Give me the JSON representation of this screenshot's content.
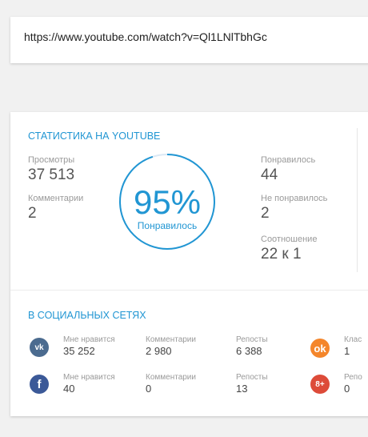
{
  "url": {
    "value": "https://www.youtube.com/watch?v=Ql1LNlTbhGc"
  },
  "youtube": {
    "title": "СТАТИСТИКА НА YOUTUBE",
    "views_label": "Просмотры",
    "views_value": "37 513",
    "comments_label": "Комментарии",
    "comments_value": "2",
    "likes_label": "Понравилось",
    "likes_value": "44",
    "dislikes_label": "Не понравилось",
    "dislikes_value": "2",
    "ratio_label": "Соотношение",
    "ratio_value": "22 к 1",
    "gauge_percent": "95%",
    "gauge_caption": "Понравилось",
    "gauge_fraction": 0.95,
    "accent_color": "#2196d3"
  },
  "social": {
    "title": "В СОЦИАЛЬНЫХ СЕТЯХ",
    "vk": {
      "icon": "vk-icon",
      "icon_text": "vk",
      "likes_label": "Мне нравится",
      "likes_value": "35 252",
      "comments_label": "Комментарии",
      "comments_value": "2 980",
      "reposts_label": "Репосты",
      "reposts_value": "6 388"
    },
    "facebook": {
      "icon": "facebook-icon",
      "icon_text": "f",
      "likes_label": "Мне нравится",
      "likes_value": "40",
      "comments_label": "Комментарии",
      "comments_value": "0",
      "reposts_label": "Репосты",
      "reposts_value": "13"
    },
    "odnoklassniki": {
      "icon": "odnoklassniki-icon",
      "icon_text": "ok",
      "label": "Клас",
      "value": "1"
    },
    "googleplus": {
      "icon": "google-plus-icon",
      "icon_text": "8+",
      "label": "Репо",
      "value": "0"
    }
  }
}
